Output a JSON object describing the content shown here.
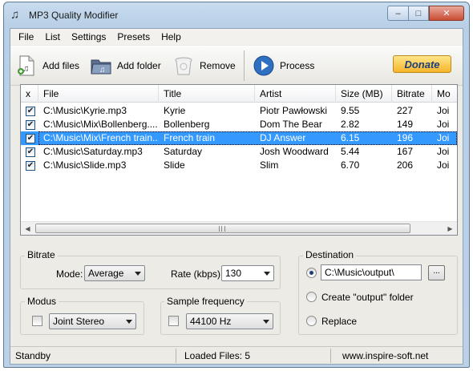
{
  "window": {
    "title": "MP3 Quality Modifier",
    "minimize": "–",
    "maximize": "□",
    "close": "✕"
  },
  "menu": [
    "File",
    "List",
    "Settings",
    "Presets",
    "Help"
  ],
  "toolbar": {
    "add_files": "Add files",
    "add_folder": "Add folder",
    "remove": "Remove",
    "process": "Process",
    "donate": "Donate"
  },
  "table": {
    "columns": [
      "x",
      "File",
      "Title",
      "Artist",
      "Size  (MB)",
      "Bitrate",
      "Mo"
    ],
    "rows": [
      {
        "checked": "✔",
        "file": "C:\\Music\\Kyrie.mp3",
        "title": "Kyrie",
        "artist": "Piotr Pawłowski",
        "size": "9.55",
        "bitrate": "227",
        "mode": "Joi"
      },
      {
        "checked": "✔",
        "file": "C:\\Music\\Mix\\Bollenberg....",
        "title": "Bollenberg",
        "artist": "Dom The Bear",
        "size": "2.82",
        "bitrate": "149",
        "mode": "Joi"
      },
      {
        "checked": "✔",
        "file": "C:\\Music\\Mix\\French train....",
        "title": "French train",
        "artist": "DJ Answer",
        "size": "6.15",
        "bitrate": "196",
        "mode": "Joi"
      },
      {
        "checked": "✔",
        "file": "C:\\Music\\Saturday.mp3",
        "title": "Saturday",
        "artist": "Josh Woodward",
        "size": "5.44",
        "bitrate": "167",
        "mode": "Joi"
      },
      {
        "checked": "✔",
        "file": "C:\\Music\\Slide.mp3",
        "title": "Slide",
        "artist": "Slim",
        "size": "6.70",
        "bitrate": "206",
        "mode": "Joi"
      }
    ],
    "selected_row": 2
  },
  "bitrate": {
    "label": "Bitrate",
    "mode_label": "Mode:",
    "mode_value": "Average",
    "rate_label": "Rate (kbps):",
    "rate_value": "130"
  },
  "modus": {
    "label": "Modus",
    "value": "Joint Stereo"
  },
  "sample": {
    "label": "Sample frequency",
    "value": "44100 Hz"
  },
  "destination": {
    "label": "Destination",
    "path": "C:\\Music\\output\\",
    "browse": "...",
    "create_output": "Create \"output\" folder",
    "replace": "Replace"
  },
  "status": {
    "state": "Standby",
    "loaded": "Loaded Files: 5",
    "website": "www.inspire-soft.net"
  }
}
